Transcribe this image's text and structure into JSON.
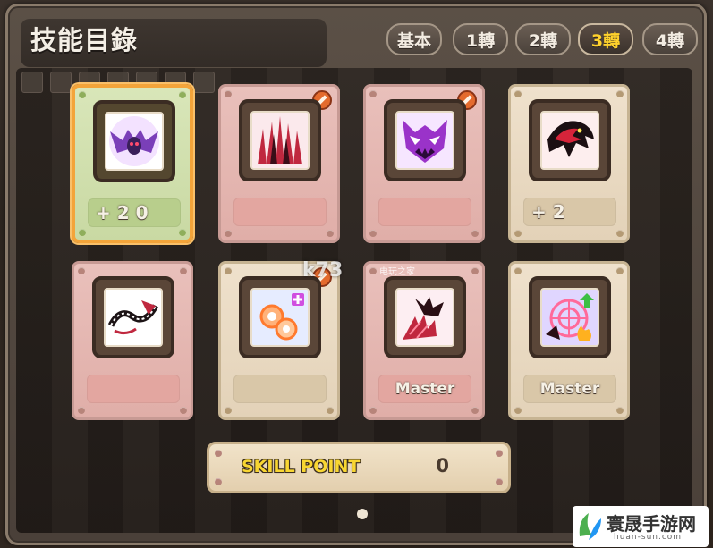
{
  "window": {
    "title": "技能目錄"
  },
  "tabs": [
    {
      "label": "基本",
      "active": false
    },
    {
      "label": "1轉",
      "active": false
    },
    {
      "label": "2轉",
      "active": false
    },
    {
      "label": "3轉",
      "active": true
    },
    {
      "label": "4轉",
      "active": false
    }
  ],
  "skills": [
    {
      "icon": "bat-demon-icon",
      "level": "+ 2 0",
      "style": "selected",
      "locked": false
    },
    {
      "icon": "red-spikes-icon",
      "level": "",
      "style": "pink",
      "locked": true
    },
    {
      "icon": "purple-demon-face-icon",
      "level": "",
      "style": "pink",
      "locked": true
    },
    {
      "icon": "red-dragon-icon",
      "level": "+ 2",
      "style": "cream",
      "locked": false
    },
    {
      "icon": "chain-serpent-icon",
      "level": "",
      "style": "pink",
      "locked": false
    },
    {
      "icon": "orange-orbs-plus-icon",
      "level": "",
      "style": "cream",
      "locked": true
    },
    {
      "icon": "bat-blood-claw-icon",
      "level": "Master",
      "style": "pink",
      "locked": false
    },
    {
      "icon": "target-flame-arrow-icon",
      "level": "Master",
      "style": "cream",
      "locked": false
    }
  ],
  "skill_point": {
    "label": "SKILL POINT",
    "value": "0"
  },
  "watermarks": {
    "k73": "k73",
    "k73_sub": "电玩之家",
    "site_name": "寰晟手游网",
    "site_url": "huan-sun.com"
  },
  "colors": {
    "active_tab": "#ffd22d",
    "skill_point_label": "#f8d632",
    "selected_border": "#f3a43a"
  }
}
